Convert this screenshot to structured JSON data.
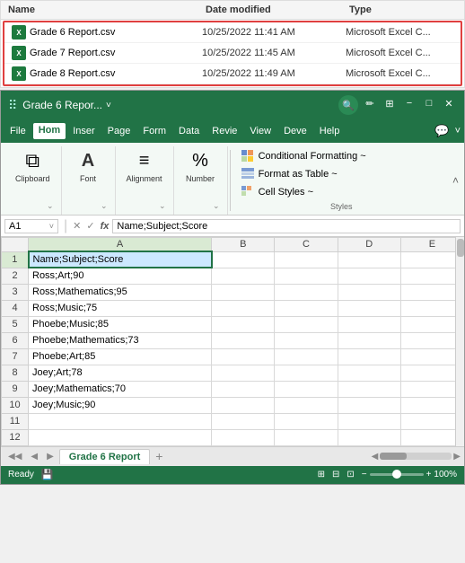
{
  "fileExplorer": {
    "headers": {
      "name": "Name",
      "dateModified": "Date modified",
      "type": "Type"
    },
    "files": [
      {
        "name": "Grade 6 Report.csv",
        "date": "10/25/2022 11:41 AM",
        "type": "Microsoft Excel C...",
        "highlighted": true
      },
      {
        "name": "Grade 7 Report.csv",
        "date": "10/25/2022 11:45 AM",
        "type": "Microsoft Excel C...",
        "highlighted": true
      },
      {
        "name": "Grade 8 Report.csv",
        "date": "10/25/2022 11:49 AM",
        "type": "Microsoft Excel C...",
        "highlighted": true
      }
    ]
  },
  "titleBar": {
    "title": "Grade 6 Repor...",
    "chevron": "˅",
    "searchBtn": "🔍",
    "icons": [
      "✏️",
      "⊞",
      "−",
      "□",
      "✕"
    ]
  },
  "menuBar": {
    "items": [
      "File",
      "Hom",
      "Inser",
      "Page",
      "Form",
      "Data",
      "Revie",
      "View",
      "Deve",
      "Help"
    ],
    "active": "Hom",
    "commentIcon": "💬"
  },
  "ribbon": {
    "groups": [
      {
        "name": "Clipboard",
        "buttons": [
          {
            "icon": "⧉",
            "label": "Clipboard"
          }
        ]
      },
      {
        "name": "Font",
        "buttons": [
          {
            "icon": "A",
            "label": ""
          }
        ]
      },
      {
        "name": "Alignment",
        "buttons": [
          {
            "icon": "≡",
            "label": ""
          }
        ]
      },
      {
        "name": "Number",
        "buttons": [
          {
            "icon": "%",
            "label": ""
          }
        ]
      }
    ],
    "styles": {
      "groupName": "Styles",
      "buttons": [
        {
          "label": "Conditional Formatting ~",
          "iconColor": "#217346"
        },
        {
          "label": "Format as Table ~",
          "iconColor": "#217346"
        },
        {
          "label": "Cell Styles ~",
          "iconColor": "#217346"
        }
      ]
    }
  },
  "formulaBar": {
    "cellRef": "A1",
    "formula": "Name;Subject;Score",
    "checkIcon": "✓",
    "crossIcon": "✕",
    "fxIcon": "fx"
  },
  "spreadsheet": {
    "colHeaders": [
      "",
      "A",
      "B",
      "C",
      "D",
      "E"
    ],
    "rows": [
      {
        "num": "1",
        "a": "Name;Subject;Score",
        "b": "",
        "c": "",
        "d": "",
        "e": "",
        "selected": true
      },
      {
        "num": "2",
        "a": "Ross;Art;90",
        "b": "",
        "c": "",
        "d": "",
        "e": ""
      },
      {
        "num": "3",
        "a": "Ross;Mathematics;95",
        "b": "",
        "c": "",
        "d": "",
        "e": ""
      },
      {
        "num": "4",
        "a": "Ross;Music;75",
        "b": "",
        "c": "",
        "d": "",
        "e": ""
      },
      {
        "num": "5",
        "a": "Phoebe;Music;85",
        "b": "",
        "c": "",
        "d": "",
        "e": ""
      },
      {
        "num": "6",
        "a": "Phoebe;Mathematics;73",
        "b": "",
        "c": "",
        "d": "",
        "e": ""
      },
      {
        "num": "7",
        "a": "Phoebe;Art;85",
        "b": "",
        "c": "",
        "d": "",
        "e": ""
      },
      {
        "num": "8",
        "a": "Joey;Art;78",
        "b": "",
        "c": "",
        "d": "",
        "e": ""
      },
      {
        "num": "9",
        "a": "Joey;Mathematics;70",
        "b": "",
        "c": "",
        "d": "",
        "e": ""
      },
      {
        "num": "10",
        "a": "Joey;Music;90",
        "b": "",
        "c": "",
        "d": "",
        "e": ""
      },
      {
        "num": "11",
        "a": "",
        "b": "",
        "c": "",
        "d": "",
        "e": ""
      },
      {
        "num": "12",
        "a": "",
        "b": "",
        "c": "",
        "d": "",
        "e": ""
      }
    ]
  },
  "sheetTabs": {
    "activeTab": "Grade 6 Report",
    "addLabel": "+"
  },
  "statusBar": {
    "ready": "Ready",
    "zoomLevel": "100%",
    "zoomMinus": "−",
    "zoomPlus": "+"
  }
}
